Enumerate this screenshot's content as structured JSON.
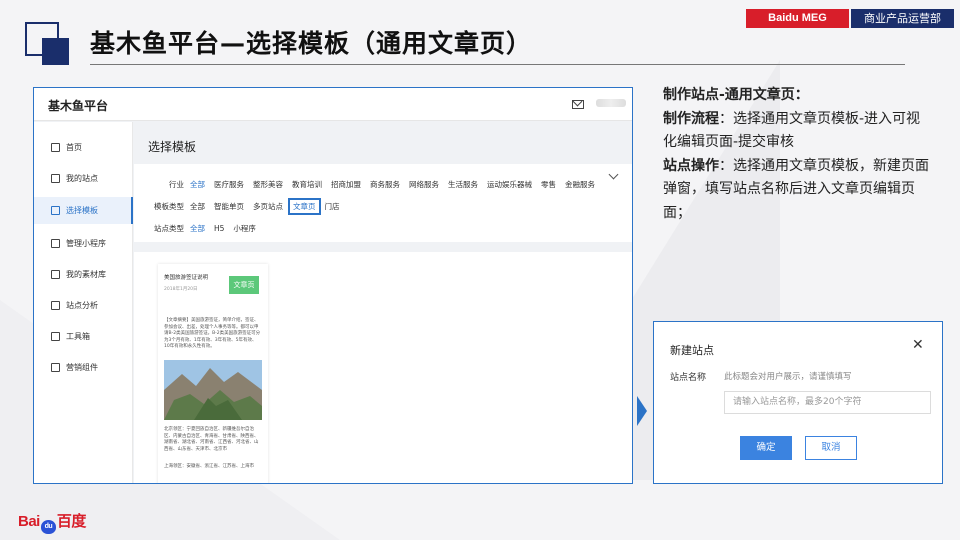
{
  "slide": {
    "title": "基木鱼平台—选择模板（通用文章页）",
    "tag_baidu": "Baidu MEG",
    "tag_dept": "商业产品运营部",
    "logo_bai": "Bai",
    "logo_du": "du",
    "logo_cn": "百度"
  },
  "app": {
    "brand": "基木鱼平台",
    "sidebar": [
      {
        "label": "首页",
        "icon": "home-icon"
      },
      {
        "label": "我的站点",
        "icon": "site-icon"
      },
      {
        "label": "选择模板",
        "icon": "template-icon",
        "active": true
      },
      {
        "label": "管理小程序",
        "icon": "miniapp-icon"
      },
      {
        "label": "我的素材库",
        "icon": "material-icon"
      },
      {
        "label": "站点分析",
        "icon": "chart-icon"
      },
      {
        "label": "工具箱",
        "icon": "toolbox-icon"
      },
      {
        "label": "营销组件",
        "icon": "component-icon"
      }
    ],
    "content_title": "选择模板",
    "filters": {
      "industry_label": "行业",
      "industry_options": [
        "全部",
        "医疗服务",
        "整形美容",
        "教育培训",
        "招商加盟",
        "商务服务",
        "网络服务",
        "生活服务",
        "运动娱乐器械",
        "零售",
        "金融服务"
      ],
      "template_label": "模板类型",
      "template_options": [
        "全部",
        "智能单页",
        "多页站点",
        "文章页",
        "门店"
      ],
      "site_label": "站点类型",
      "site_options": [
        "全部",
        "H5",
        "小程序"
      ]
    },
    "card": {
      "title": "美国旅游签证说明",
      "date": "2018年1月20日",
      "badge": "文章页",
      "intro": "【文章摘要】美国旅游签证，简单介绍，签证、参加会议、出差，处理个人事务等等。都可以申请B-2类美国旅游签证。B-2类美国旅游签证可分为3个月有效、1年有效、3年有效、5年有效、10年有效和永久性有效。",
      "body": "北京领区：宁夏回族自治区、新疆维吾尔自治区、内蒙古自治区、青海省、甘肃省、陕西省、湖南省、湖北省、河南省、江西省、河北省、山西省、山东省、天津市、北京市",
      "body2": "上海领区：安徽省、浙江省、江苏省、上海市"
    }
  },
  "notes": {
    "heading": "制作站点-通用文章页：",
    "flow_label": "制作流程",
    "flow_text": "：选择通用文章页模板-进入可视化编辑页面-提交审核",
    "op_label": "站点操作",
    "op_text": "：选择通用文章页模板，新建页面弹窗，填写站点名称后进入文章页编辑页面；"
  },
  "dialog": {
    "title": "新建站点",
    "close": "✕",
    "field_label": "站点名称",
    "hint": "此标题会对用户展示，请谨慎填写",
    "placeholder": "请输入站点名称，最多20个字符",
    "ok": "确定",
    "cancel": "取消"
  }
}
